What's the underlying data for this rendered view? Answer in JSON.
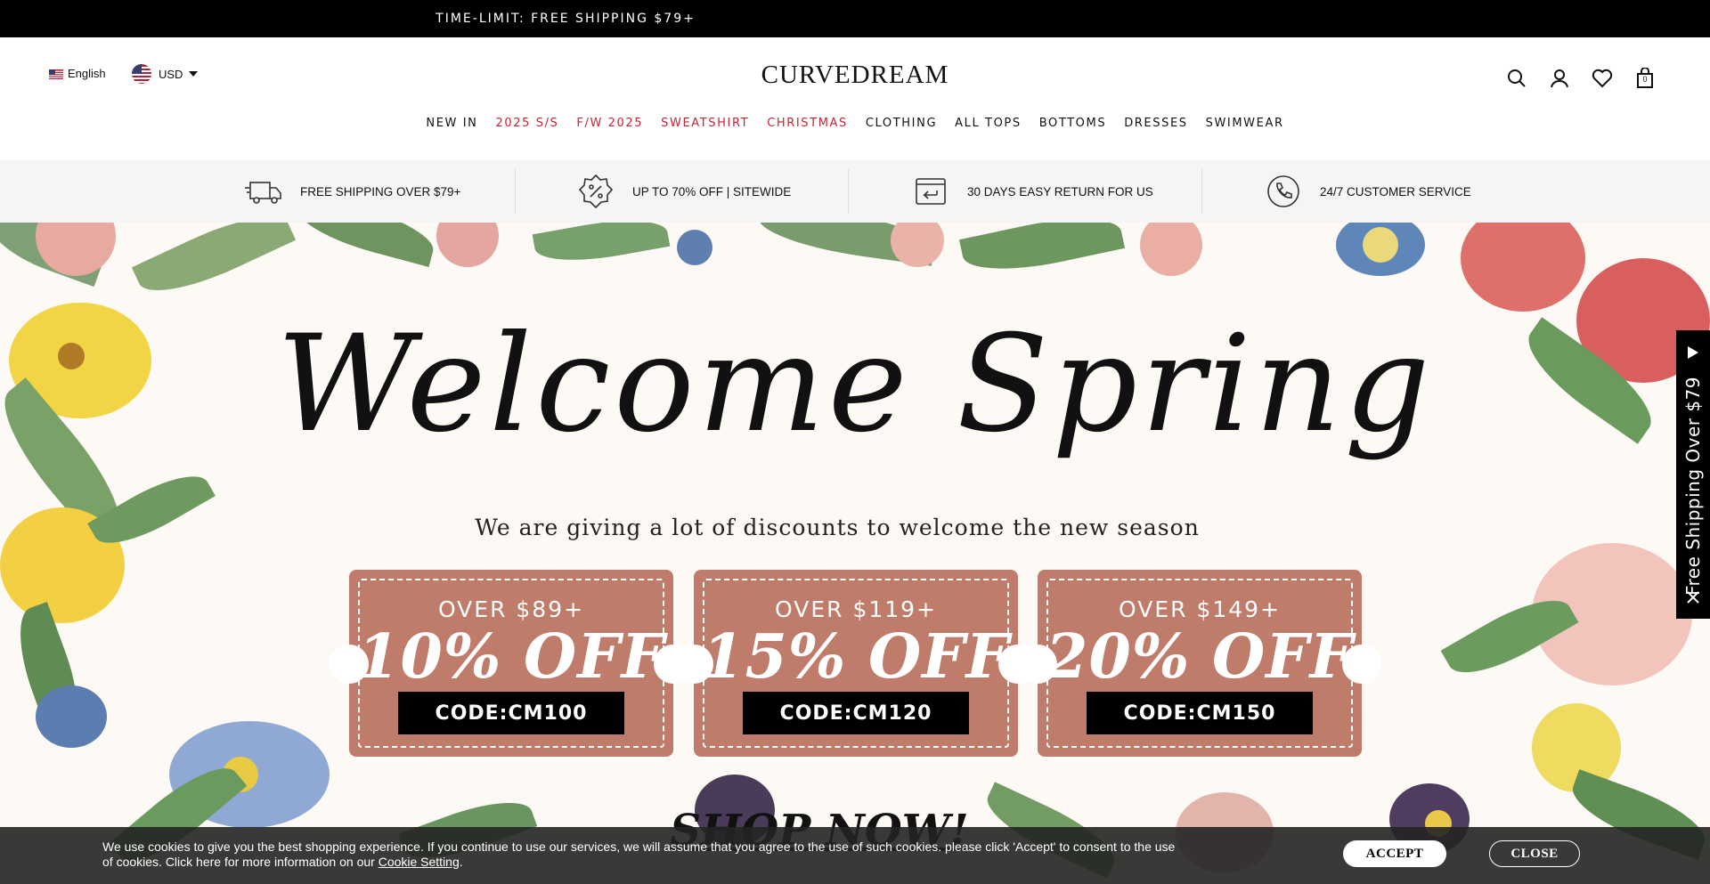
{
  "topbar": {
    "text": "TIME-LIMIT: FREE SHIPPING $79+"
  },
  "header": {
    "language": "English",
    "currency": "USD",
    "logo": "CURVEDREAM",
    "cart_count": "0"
  },
  "nav": {
    "items": [
      {
        "label": "NEW IN"
      },
      {
        "label": "2025 S/S"
      },
      {
        "label": "F/W 2025"
      },
      {
        "label": "SWEATSHIRT"
      },
      {
        "label": "CHRISTMAS"
      },
      {
        "label": "CLOTHING"
      },
      {
        "label": "ALL TOPS"
      },
      {
        "label": "BOTTOMS"
      },
      {
        "label": "DRESSES"
      },
      {
        "label": "SWIMWEAR"
      }
    ],
    "highlight_color": "#c82432"
  },
  "benefits": [
    {
      "icon": "truck-icon",
      "label": "FREE SHIPPING OVER $79+"
    },
    {
      "icon": "percent-badge-icon",
      "label": "UP TO 70% OFF | SITEWIDE"
    },
    {
      "icon": "return-box-icon",
      "label": "30 DAYS EASY RETURN FOR US"
    },
    {
      "icon": "phone-icon",
      "label": "24/7 CUSTOMER SERVICE"
    }
  ],
  "hero": {
    "headline": "Welcome Spring",
    "tagline": "We are giving a lot of discounts to welcome the new season",
    "coupons": [
      {
        "threshold": "OVER  $89+",
        "discount": "10% OFF",
        "code": "CODE:CM100"
      },
      {
        "threshold": "OVER  $119+",
        "discount": "15% OFF",
        "code": "CODE:CM120"
      },
      {
        "threshold": "OVER  $149+",
        "discount": "20% OFF",
        "code": "CODE:CM150"
      }
    ],
    "cta": "SHOP NOW!",
    "coupon_color": "#c07c6a"
  },
  "sidetab": {
    "text": "Free Shipping Over $79"
  },
  "cookie": {
    "text_before": "We use cookies to give you the best shopping experience. If you continue to use our services, we will assume that you agree to the use of such cookies. please click 'Accept' to consent to the use of cookies. Click here for more information on our ",
    "link": "Cookie Setting",
    "text_after": ".",
    "accept": "ACCEPT",
    "close": "CLOSE"
  }
}
